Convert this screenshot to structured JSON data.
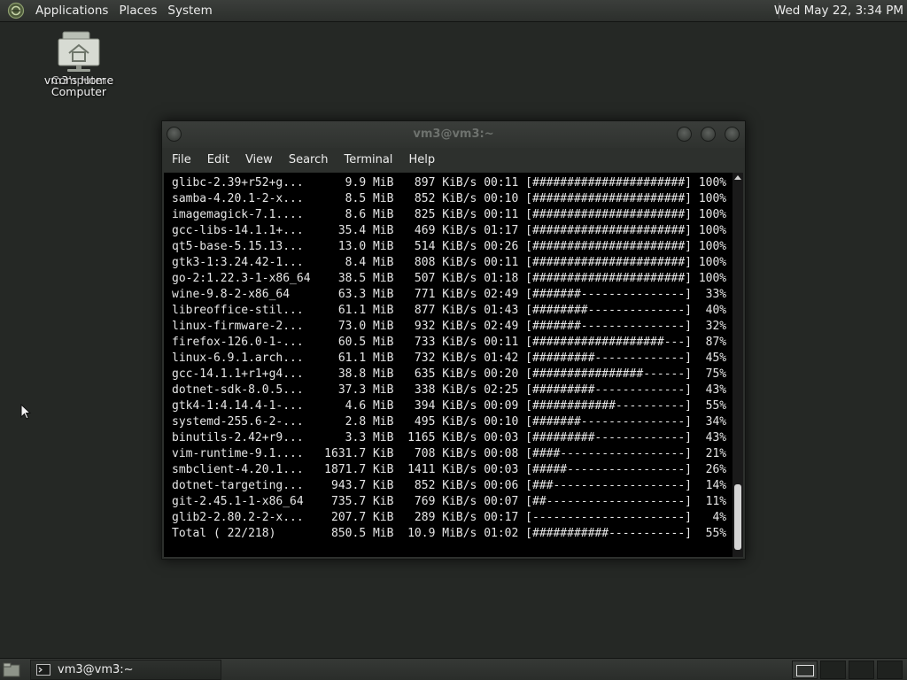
{
  "top_panel": {
    "menus": [
      "Applications",
      "Places",
      "System"
    ],
    "clock": "Wed May 22,  3:34 PM"
  },
  "desktop": {
    "icon_label_line1": "vm3's Home",
    "icon_label_overlap": "Computer",
    "icon_label_line2": "Computer"
  },
  "window": {
    "title": "vm3@vm3:~",
    "menu": [
      "File",
      "Edit",
      "View",
      "Search",
      "Terminal",
      "Help"
    ]
  },
  "terminal": {
    "downloads": [
      {
        "name": "glibc-2.39+r52+g...",
        "size": "9.9",
        "unit": "MiB",
        "rate": "897 KiB/s",
        "eta": "00:11",
        "bar": "[######################]",
        "pct": "100%"
      },
      {
        "name": "samba-4.20.1-2-x...",
        "size": "8.5",
        "unit": "MiB",
        "rate": "852 KiB/s",
        "eta": "00:10",
        "bar": "[######################]",
        "pct": "100%"
      },
      {
        "name": "imagemagick-7.1....",
        "size": "8.6",
        "unit": "MiB",
        "rate": "825 KiB/s",
        "eta": "00:11",
        "bar": "[######################]",
        "pct": "100%"
      },
      {
        "name": "gcc-libs-14.1.1+...",
        "size": "35.4",
        "unit": "MiB",
        "rate": "469 KiB/s",
        "eta": "01:17",
        "bar": "[######################]",
        "pct": "100%"
      },
      {
        "name": "qt5-base-5.15.13...",
        "size": "13.0",
        "unit": "MiB",
        "rate": "514 KiB/s",
        "eta": "00:26",
        "bar": "[######################]",
        "pct": "100%"
      },
      {
        "name": "gtk3-1:3.24.42-1...",
        "size": "8.4",
        "unit": "MiB",
        "rate": "808 KiB/s",
        "eta": "00:11",
        "bar": "[######################]",
        "pct": "100%"
      },
      {
        "name": "go-2:1.22.3-1-x86_64",
        "size": "38.5",
        "unit": "MiB",
        "rate": "507 KiB/s",
        "eta": "01:18",
        "bar": "[######################]",
        "pct": "100%"
      },
      {
        "name": "wine-9.8-2-x86_64",
        "size": "63.3",
        "unit": "MiB",
        "rate": "771 KiB/s",
        "eta": "02:49",
        "bar": "[#######---------------]",
        "pct": "33%"
      },
      {
        "name": "libreoffice-stil...",
        "size": "61.1",
        "unit": "MiB",
        "rate": "877 KiB/s",
        "eta": "01:43",
        "bar": "[########--------------]",
        "pct": "40%"
      },
      {
        "name": "linux-firmware-2...",
        "size": "73.0",
        "unit": "MiB",
        "rate": "932 KiB/s",
        "eta": "02:49",
        "bar": "[#######---------------]",
        "pct": "32%"
      },
      {
        "name": "firefox-126.0-1-...",
        "size": "60.5",
        "unit": "MiB",
        "rate": "733 KiB/s",
        "eta": "00:11",
        "bar": "[###################---]",
        "pct": "87%"
      },
      {
        "name": "linux-6.9.1.arch...",
        "size": "61.1",
        "unit": "MiB",
        "rate": "732 KiB/s",
        "eta": "01:42",
        "bar": "[#########-------------]",
        "pct": "45%"
      },
      {
        "name": "gcc-14.1.1+r1+g4...",
        "size": "38.8",
        "unit": "MiB",
        "rate": "635 KiB/s",
        "eta": "00:20",
        "bar": "[################------]",
        "pct": "75%"
      },
      {
        "name": "dotnet-sdk-8.0.5...",
        "size": "37.3",
        "unit": "MiB",
        "rate": "338 KiB/s",
        "eta": "02:25",
        "bar": "[#########-------------]",
        "pct": "43%"
      },
      {
        "name": "gtk4-1:4.14.4-1-...",
        "size": "4.6",
        "unit": "MiB",
        "rate": "394 KiB/s",
        "eta": "00:09",
        "bar": "[############----------]",
        "pct": "55%"
      },
      {
        "name": "systemd-255.6-2-...",
        "size": "2.8",
        "unit": "MiB",
        "rate": "495 KiB/s",
        "eta": "00:10",
        "bar": "[#######---------------]",
        "pct": "34%"
      },
      {
        "name": "binutils-2.42+r9...",
        "size": "3.3",
        "unit": "MiB",
        "rate": "1165 KiB/s",
        "eta": "00:03",
        "bar": "[#########-------------]",
        "pct": "43%"
      },
      {
        "name": "vim-runtime-9.1....",
        "size": "1631.7",
        "unit": "KiB",
        "rate": "708 KiB/s",
        "eta": "00:08",
        "bar": "[####------------------]",
        "pct": "21%"
      },
      {
        "name": "smbclient-4.20.1...",
        "size": "1871.7",
        "unit": "KiB",
        "rate": "1411 KiB/s",
        "eta": "00:03",
        "bar": "[#####-----------------]",
        "pct": "26%"
      },
      {
        "name": "dotnet-targeting...",
        "size": "943.7",
        "unit": "KiB",
        "rate": "852 KiB/s",
        "eta": "00:06",
        "bar": "[###-------------------]",
        "pct": "14%"
      },
      {
        "name": "git-2.45.1-1-x86_64",
        "size": "735.7",
        "unit": "KiB",
        "rate": "769 KiB/s",
        "eta": "00:07",
        "bar": "[##--------------------]",
        "pct": "11%"
      },
      {
        "name": "glib2-2.80.2-2-x...",
        "size": "207.7",
        "unit": "KiB",
        "rate": "289 KiB/s",
        "eta": "00:17",
        "bar": "[----------------------]",
        "pct": "4%"
      }
    ],
    "total": {
      "name": "Total ( 22/218)",
      "size": "850.5",
      "unit": "MiB",
      "rate": "10.9 MiB/s",
      "eta": "01:02",
      "bar": "[###########-----------]",
      "pct": "55%"
    }
  },
  "taskbar": {
    "task_label": "vm3@vm3:~"
  }
}
